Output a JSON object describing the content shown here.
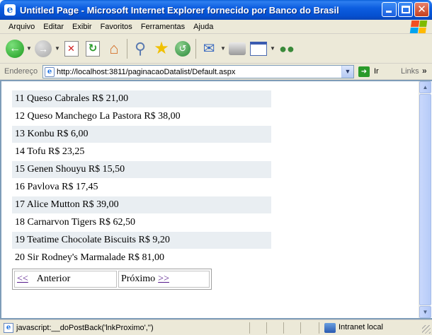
{
  "window": {
    "title": "Untitled Page - Microsoft Internet Explorer fornecido por Banco do Brasil",
    "icon": "ie-icon"
  },
  "menu": {
    "items": [
      "Arquivo",
      "Editar",
      "Exibir",
      "Favoritos",
      "Ferramentas",
      "Ajuda"
    ]
  },
  "toolbar": {
    "icons": [
      "back-icon",
      "forward-icon",
      "stop-icon",
      "refresh-icon",
      "home-icon",
      "search-icon",
      "favorites-icon",
      "history-icon",
      "mail-icon",
      "print-icon",
      "edit-icon",
      "messenger-icon"
    ]
  },
  "address": {
    "label": "Endereço",
    "url": "http://localhost:3811/paginacaoDatalist/Default.aspx",
    "go_label": "Ir",
    "links_label": "Links"
  },
  "products": [
    {
      "text": "11 Queso Cabrales R$ 21,00"
    },
    {
      "text": "12 Queso Manchego La Pastora R$ 38,00"
    },
    {
      "text": "13 Konbu R$ 6,00"
    },
    {
      "text": "14 Tofu R$ 23,25"
    },
    {
      "text": "15 Genen Shouyu R$ 15,50"
    },
    {
      "text": "16 Pavlova R$ 17,45"
    },
    {
      "text": "17 Alice Mutton R$ 39,00"
    },
    {
      "text": "18 Carnarvon Tigers R$ 62,50"
    },
    {
      "text": "19 Teatime Chocolate Biscuits R$ 9,20"
    },
    {
      "text": "20 Sir Rodney's Marmalade R$ 81,00"
    }
  ],
  "pager": {
    "prev_link": "<<",
    "prev_label": "Anterior",
    "next_label": "Próximo",
    "next_link": ">>"
  },
  "status": {
    "text": "javascript:__doPostBack('lnkProximo','')",
    "zone": "Intranet local"
  },
  "colors": {
    "titlebar": "#0550d0",
    "alt_row": "#e9eef2",
    "link": "#551a8b"
  }
}
